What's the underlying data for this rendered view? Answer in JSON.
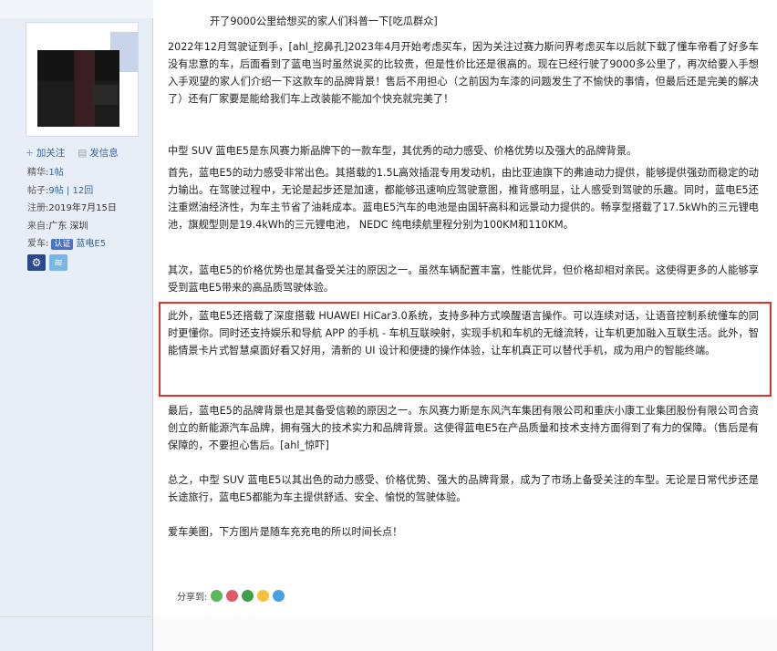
{
  "sidebar": {
    "actions": {
      "follow": "加关注",
      "message": "发信息"
    },
    "stats": [
      {
        "label": "精华:",
        "value": "1帖"
      },
      {
        "label": "帖子:",
        "value": "9帖 | 12回"
      },
      {
        "label": "注册:",
        "value": "2019年7月15日"
      },
      {
        "label": "来自:",
        "value": "广东 深圳"
      }
    ],
    "car": {
      "label": "爱车:",
      "badge": "认证",
      "model": "蓝电E5"
    }
  },
  "post": {
    "title": "开了9000公里给想买的家人们科普一下[吃瓜群众]",
    "p1": "2022年12月驾驶证到手，[ahl_挖鼻孔]2023年4月开始考虑买车，因为关注过赛力斯问界考虑买车以后就下载了懂车帝看了好多车没有忠意的车，后面看到了蓝电当时虽然说买的比较贵，但是性价比还是很高的。现在已经行驶了9000多公里了，再次给要入手想入手观望的家人们介绍一下这款车的品牌背景！售后不用担心（之前因为车漆的问题发生了不愉快的事情，但最后还是完美的解决了）还有厂家要是能给我们车上改装能不能加个快充就完美了！",
    "p2": "中型 SUV 蓝电E5是东风赛力斯品牌下的一款车型，其优秀的动力感受、价格优势以及强大的品牌背景。",
    "p3": "首先，蓝电E5的动力感受非常出色。其搭载的1.5L高效插混专用发动机，由比亚迪旗下的弗迪动力提供，能够提供强劲而稳定的动力输出。在驾驶过程中，无论是起步还是加速，都能够迅速响应驾驶意图，推背感明显，让人感受到驾驶的乐趣。同时，蓝电E5还注重燃油经济性，为车主节省了油耗成本。蓝电E5汽车的电池是由国轩高科和远景动力提供的。畅享型搭载了17.5kWh的三元锂电池，旗舰型则是19.4kWh的三元锂电池， NEDC 纯电续航里程分别为100KM和110KM。",
    "p4": "其次，蓝电E5的价格优势也是其备受关注的原因之一。虽然车辆配置丰富，性能优异，但价格却相对亲民。这使得更多的人能够享受到蓝电E5带来的高品质驾驶体验。",
    "p5": "此外，蓝电E5还搭载了深度搭载 HUAWEI HiCar3.0系统，支持多种方式唤醒语言操作。可以连续对话，让语音控制系统懂车的同时更懂你。同时还支持娱乐和导航 APP 的手机 - 车机互联映射，实现手机和车机的无缝流转，让车机更加融入互联生活。此外，智能情景卡片式智慧桌面好看又好用，清新的 UI 设计和便捷的操作体验，让车机真正可以替代手机，成为用户的智能终端。",
    "p6": "最后，蓝电E5的品牌背景也是其备受信赖的原因之一。东风赛力斯是东风汽车集团有限公司和重庆小康工业集团股份有限公司合资创立的新能源汽车品牌，拥有强大的技术实力和品牌背景。这使得蓝电E5在产品质量和技术支持方面得到了有力的保障。（售后是有保障的，不要担心售后。[ahl_惊吓]",
    "p7": "总之，中型 SUV 蓝电E5以其出色的动力感受、价格优势、强大的品牌背景，成为了市场上备受关注的车型。无论是日常代步还是长途旅行，蓝电E5都能为车主提供舒适、安全、愉悦的驾驶体验。",
    "p8": "爱车美图，下方图片是随车充充电的所以时间长点！"
  },
  "share": {
    "label": "分享到:"
  },
  "colors": {
    "highlight": "#d9362b",
    "link": "#3366aa"
  }
}
